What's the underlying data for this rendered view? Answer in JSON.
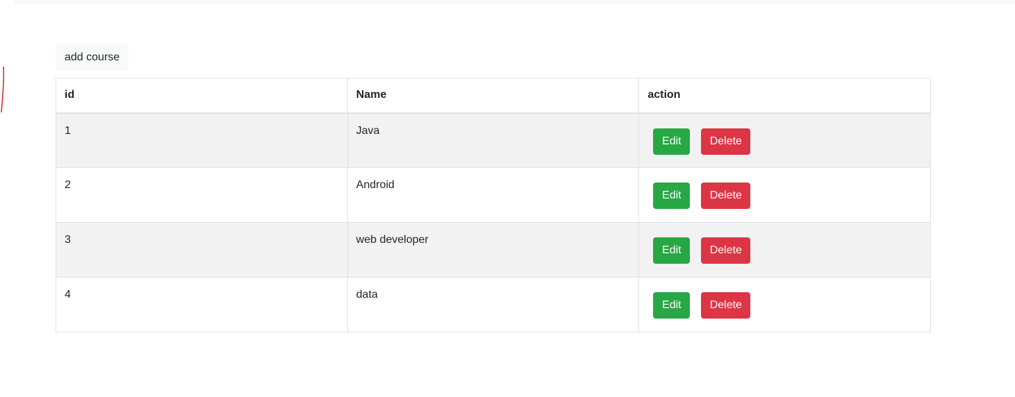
{
  "toolbar": {
    "add_label": "add course"
  },
  "table": {
    "headers": [
      "id",
      "Name",
      "action"
    ],
    "rows": [
      {
        "id": "1",
        "name": "Java",
        "edit": "Edit",
        "delete": "Delete"
      },
      {
        "id": "2",
        "name": "Android",
        "edit": "Edit",
        "delete": "Delete"
      },
      {
        "id": "3",
        "name": "web developer",
        "edit": "Edit",
        "delete": "Delete"
      },
      {
        "id": "4",
        "name": "data",
        "edit": "Edit",
        "delete": "Delete"
      }
    ]
  },
  "colors": {
    "edit": "#28a745",
    "delete": "#dc3545",
    "stripe": "#f2f2f2",
    "border": "#dee2e6",
    "annotation": "#e0201b"
  }
}
